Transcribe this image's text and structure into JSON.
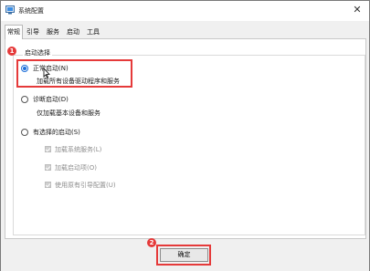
{
  "window": {
    "title": "系统配置",
    "close_glyph": "✕"
  },
  "tabs": [
    {
      "label": "常规",
      "active": true
    },
    {
      "label": "引导",
      "active": false
    },
    {
      "label": "服务",
      "active": false
    },
    {
      "label": "启动",
      "active": false
    },
    {
      "label": "工具",
      "active": false
    }
  ],
  "startup_selection": {
    "group_title": "启动选择",
    "normal": {
      "label": "正常启动(N)",
      "description": "加载所有设备驱动程序和服务",
      "selected": true
    },
    "diagnostic": {
      "label": "诊断启动(D)",
      "description": "仅加载基本设备和服务",
      "selected": false
    },
    "selective": {
      "label": "有选择的启动(S)",
      "selected": false,
      "options": [
        {
          "label": "加载系统服务(L)",
          "checked": true,
          "disabled": true
        },
        {
          "label": "加载启动项(O)",
          "checked": true,
          "disabled": true
        },
        {
          "label": "使用原有引导配置(U)",
          "checked": true,
          "disabled": true
        }
      ]
    }
  },
  "annotations": {
    "badge_1": "1",
    "badge_2": "2",
    "highlight_color": "#e53a3a"
  },
  "buttons": {
    "ok_label": "确定"
  }
}
